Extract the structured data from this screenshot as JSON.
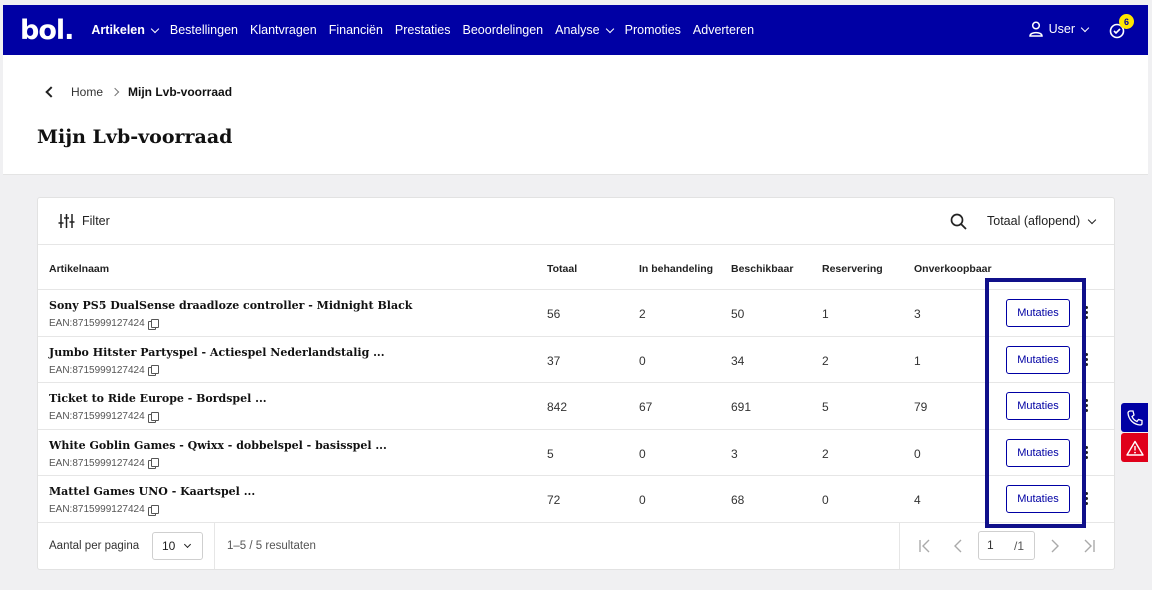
{
  "app": {
    "logo": "bol."
  },
  "nav": {
    "items": [
      {
        "label": "Artikelen",
        "active": true,
        "dropdown": true
      },
      {
        "label": "Bestellingen"
      },
      {
        "label": "Klantvragen"
      },
      {
        "label": "Financiën"
      },
      {
        "label": "Prestaties"
      },
      {
        "label": "Beoordelingen"
      },
      {
        "label": "Analyse",
        "dropdown": true
      },
      {
        "label": "Promoties"
      },
      {
        "label": "Adverteren"
      }
    ],
    "user_label": "User",
    "notification_count": "6"
  },
  "breadcrumb": {
    "home": "Home",
    "current": "Mijn Lvb-voorraad"
  },
  "page_title": "Mijn Lvb-voorraad",
  "toolbar": {
    "filter_label": "Filter",
    "sort_label": "Totaal (aflopend)"
  },
  "table": {
    "columns": [
      "Artikelnaam",
      "Totaal",
      "In behandeling",
      "Beschikbaar",
      "Reservering",
      "Onverkoopbaar"
    ],
    "ean_prefix": "EAN: ",
    "action_label": "Mutaties",
    "rows": [
      {
        "name": "Sony PS5 DualSense draadloze controller - Midnight Black",
        "ean": "8715999127424",
        "totaal": "56",
        "in_behandeling": "2",
        "beschikbaar": "50",
        "reservering": "1",
        "onverkoopbaar": "3"
      },
      {
        "name": "Jumbo Hitster Partyspel - Actiespel Nederlandstalig ...",
        "ean": "8715999127424",
        "totaal": "37",
        "in_behandeling": "0",
        "beschikbaar": "34",
        "reservering": "2",
        "onverkoopbaar": "1"
      },
      {
        "name": "Ticket to Ride Europe - Bordspel ...",
        "ean": "8715999127424",
        "totaal": "842",
        "in_behandeling": "67",
        "beschikbaar": "691",
        "reservering": "5",
        "onverkoopbaar": "79"
      },
      {
        "name": "White Goblin Games - Qwixx - dobbelspel - basisspel ...",
        "ean": "8715999127424",
        "totaal": "5",
        "in_behandeling": "0",
        "beschikbaar": "3",
        "reservering": "2",
        "onverkoopbaar": "0"
      },
      {
        "name": "Mattel Games UNO - Kaartspel ...",
        "ean": "8715999127424",
        "totaal": "72",
        "in_behandeling": "0",
        "beschikbaar": "68",
        "reservering": "0",
        "onverkoopbaar": "4"
      }
    ]
  },
  "pagination": {
    "per_page_label": "Aantal per pagina",
    "per_page_value": "10",
    "results_text": "1–5 / 5 resultaten",
    "current_page": "1",
    "total_pages": "/1"
  },
  "colors": {
    "brand": "#0000a4",
    "badge": "#ffe600",
    "alert": "#e0001b"
  }
}
